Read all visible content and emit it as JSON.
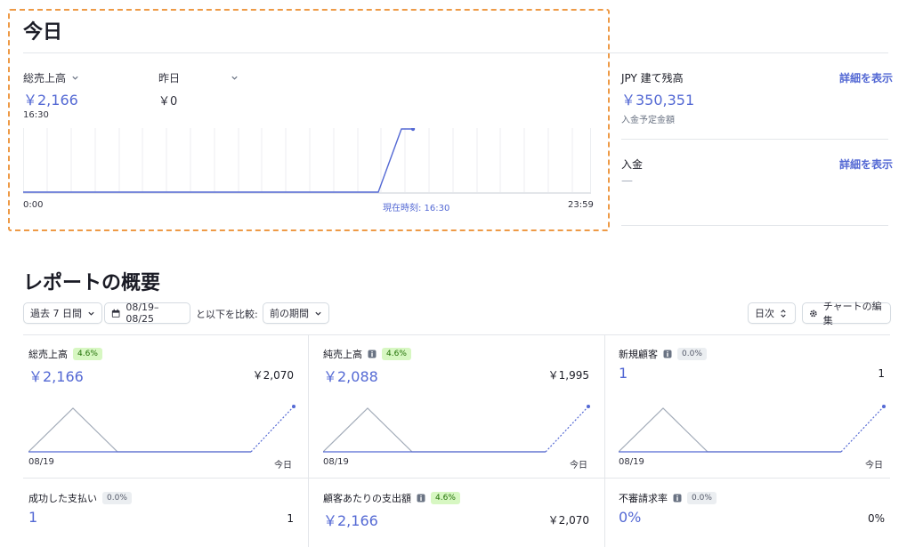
{
  "today": {
    "title": "今日",
    "gross_label": "総売上高",
    "gross_value": "￥2,166",
    "yesterday_label": "昨日",
    "yesterday_value": "￥0",
    "time_label": "16:30",
    "axis_start": "0:00",
    "axis_now": "現在時刻: 16:30",
    "axis_end": "23:59"
  },
  "balance": {
    "label": "JPY 建て残高",
    "link": "詳細を表示",
    "value": "￥350,351",
    "sub": "入金予定金額"
  },
  "payouts": {
    "label": "入金",
    "link": "詳細を表示",
    "value": "—"
  },
  "report": {
    "title": "レポートの概要",
    "range_select": "過去 7 日間",
    "date_range": "08/19–08/25",
    "compare_label": "と以下を比較:",
    "compare_select": "前の期間",
    "interval_select": "日次",
    "edit_chart": "チャートの編集"
  },
  "cards": [
    {
      "label": "総売上高",
      "badge": "4.6%",
      "badge_type": "green",
      "info": false,
      "value": "￥2,166",
      "prev": "￥2,070",
      "x_start": "08/19",
      "x_end": "今日"
    },
    {
      "label": "純売上高",
      "badge": "4.6%",
      "badge_type": "green",
      "info": true,
      "value": "￥2,088",
      "prev": "￥1,995",
      "x_start": "08/19",
      "x_end": "今日"
    },
    {
      "label": "新規顧客",
      "badge": "0.0%",
      "badge_type": "gray",
      "info": true,
      "value": "1",
      "prev": "1",
      "x_start": "08/19",
      "x_end": "今日"
    },
    {
      "label": "成功した支払い",
      "badge": "0.0%",
      "badge_type": "gray",
      "info": false,
      "value": "1",
      "prev": "1"
    },
    {
      "label": "顧客あたりの支出額",
      "badge": "4.6%",
      "badge_type": "green",
      "info": true,
      "value": "￥2,166",
      "prev": "￥2,070"
    },
    {
      "label": "不審請求率",
      "badge": "0.0%",
      "badge_type": "gray",
      "info": true,
      "value": "0%",
      "prev": "0%"
    }
  ],
  "colors": {
    "accent": "#5469d4",
    "frame": "#ee9a46",
    "badge_green_bg": "#d7f7c2",
    "badge_gray_bg": "#ebeef1"
  }
}
